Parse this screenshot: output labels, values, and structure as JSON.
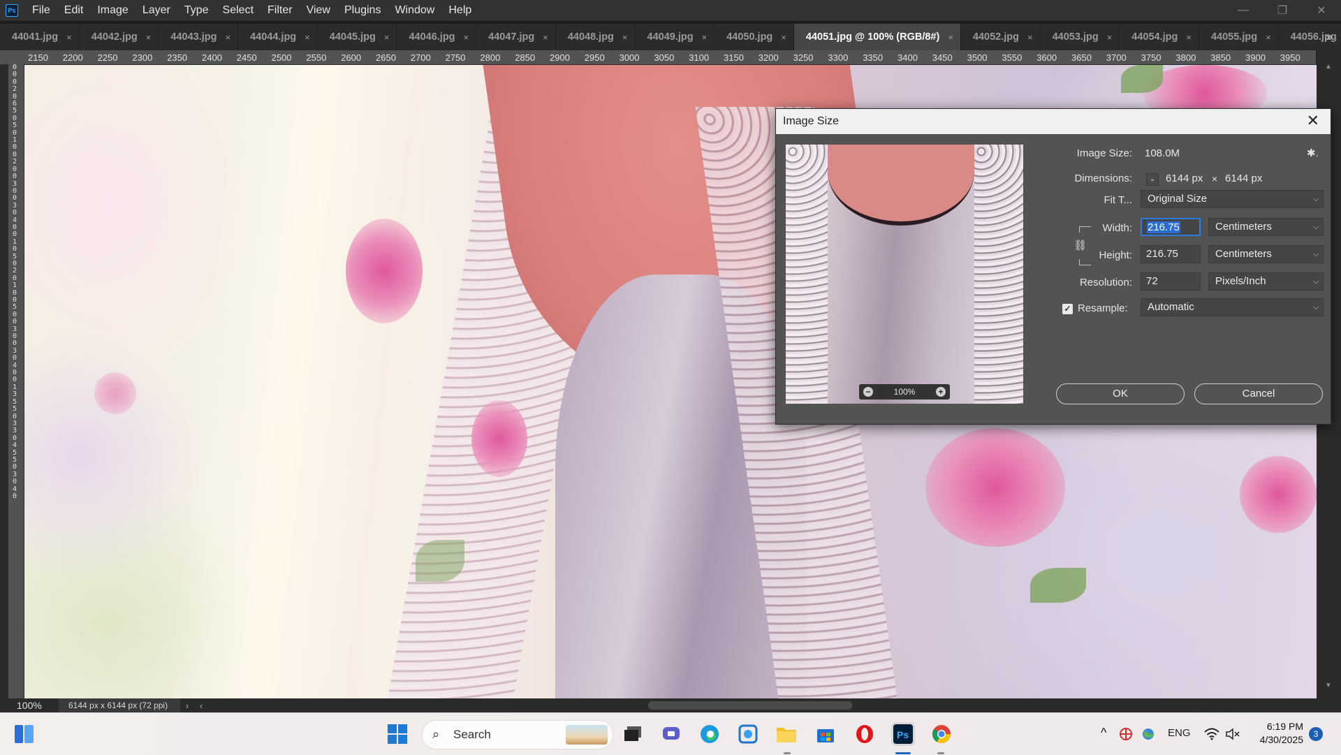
{
  "app": {
    "logo": "Ps",
    "menu": [
      "File",
      "Edit",
      "Image",
      "Layer",
      "Type",
      "Select",
      "Filter",
      "View",
      "Plugins",
      "Window",
      "Help"
    ],
    "window_controls": {
      "minimize": "—",
      "maximize": "❐",
      "close": "✕"
    }
  },
  "tabs": [
    {
      "label": "44041.jpg",
      "active": false
    },
    {
      "label": "44042.jpg",
      "active": false
    },
    {
      "label": "44043.jpg",
      "active": false
    },
    {
      "label": "44044.jpg",
      "active": false
    },
    {
      "label": "44045.jpg",
      "active": false
    },
    {
      "label": "44046.jpg",
      "active": false
    },
    {
      "label": "44047.jpg",
      "active": false
    },
    {
      "label": "44048.jpg",
      "active": false
    },
    {
      "label": "44049.jpg",
      "active": false
    },
    {
      "label": "44050.jpg",
      "active": false
    },
    {
      "label": "44051.jpg @ 100% (RGB/8#)",
      "active": true
    },
    {
      "label": "44052.jpg",
      "active": false
    },
    {
      "label": "44053.jpg",
      "active": false
    },
    {
      "label": "44054.jpg",
      "active": false
    },
    {
      "label": "44055.jpg",
      "active": false
    },
    {
      "label": "44056.jpg",
      "active": false
    }
  ],
  "tab_close_glyph": "×",
  "tab_overflow_glyph": "»",
  "ruler_h_ticks": [
    "2150",
    "2200",
    "2250",
    "2300",
    "2350",
    "2400",
    "2450",
    "2500",
    "2550",
    "2600",
    "2650",
    "2700",
    "2750",
    "2800",
    "2850",
    "2900",
    "2950",
    "3000",
    "3050",
    "3100",
    "3150",
    "3200",
    "3250",
    "3300",
    "3350",
    "3400",
    "3450",
    "3500",
    "3550",
    "3600",
    "3650",
    "3700",
    "3750",
    "3800",
    "3850",
    "3900",
    "3950"
  ],
  "ruler_v_text": "0 0 0 2 0 6 5 0 5 0 1 0 0 2 0 0 3 0 0 3 0 4 0 0 1 0 5 0 2 0 1 0 0 5 0 0 3 0 0 3 0 4 0 0 1 3 5 5 0 3 3 0 4 5 5 0 3 0 4 0",
  "status": {
    "zoom": "100%",
    "doc_info": "6144 px x 6144 px (72 ppi)",
    "arrow_right": "›",
    "arrow_left": "‹"
  },
  "dialog": {
    "title": "Image Size",
    "close_glyph": "✕",
    "preview_zoom": "100%",
    "zoom_out_glyph": "−",
    "zoom_in_glyph": "+",
    "image_size_label": "Image Size:",
    "image_size_value": "108.0M",
    "gear_glyph": "✱.",
    "dimensions_label": "Dimensions:",
    "dimensions_toggle": "⌄",
    "dim_width": "6144 px",
    "dim_times": "×",
    "dim_height": "6144 px",
    "fit_label": "Fit T...",
    "fit_value": "Original Size",
    "width_label": "Width:",
    "width_value": "216.75",
    "width_unit": "Centimeters",
    "height_label": "Height:",
    "height_value": "216.75",
    "height_unit": "Centimeters",
    "resolution_label": "Resolution:",
    "resolution_value": "72",
    "resolution_unit": "Pixels/Inch",
    "resample_label": "Resample:",
    "resample_checked": true,
    "resample_check_glyph": "✓",
    "resample_value": "Automatic",
    "chain_glyph": "⛓",
    "chevron": "⌵",
    "ok_label": "OK",
    "cancel_label": "Cancel"
  },
  "taskbar": {
    "search_placeholder": "Search",
    "search_icon": "search-icon",
    "tray": {
      "chevron": "^",
      "language": "ENG",
      "time": "6:19 PM",
      "date": "4/30/2025",
      "notifications": "3"
    }
  }
}
